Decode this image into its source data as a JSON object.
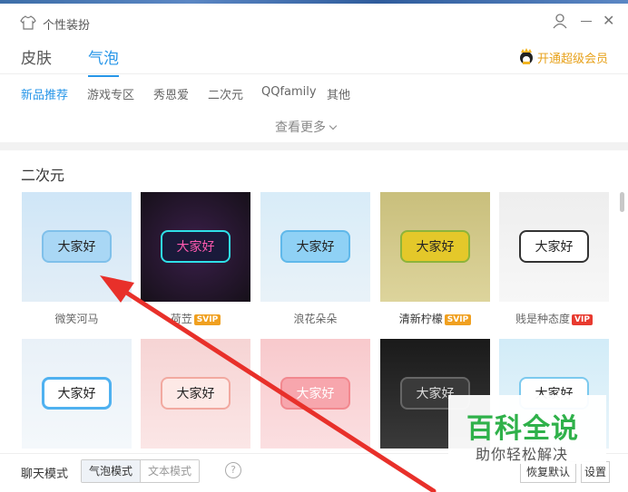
{
  "window": {
    "title": "个性装扮",
    "icons": {
      "app": "shirt-icon",
      "user": "user-icon",
      "minimize": "minimize-icon",
      "close": "close-icon"
    },
    "close_glyph": "✕"
  },
  "main_tabs": [
    {
      "label": "皮肤",
      "active": false
    },
    {
      "label": "气泡",
      "active": true
    }
  ],
  "vip": {
    "label": "开通超级会员",
    "icon": "vip-penguin-icon",
    "color": "#e7a11a"
  },
  "sub_tabs": [
    {
      "label": "新品推荐",
      "active": true
    },
    {
      "label": "游戏专区",
      "active": false
    },
    {
      "label": "秀恩爱",
      "active": false
    },
    {
      "label": "二次元",
      "active": false
    },
    {
      "label": "QQfamily",
      "active": false
    },
    {
      "label": "其他",
      "active": false
    }
  ],
  "see_more": "查看更多",
  "section": {
    "title": "二次元"
  },
  "tiles": [
    {
      "name": "微笑河马",
      "bubble_text": "大家好",
      "tag": ""
    },
    {
      "name": "荷苙",
      "bubble_text": "大家好",
      "tag": "SVIP"
    },
    {
      "name": "浪花朵朵",
      "bubble_text": "大家好",
      "tag": ""
    },
    {
      "name": "清新柠檬",
      "bubble_text": "大家好",
      "tag": "SVIP"
    },
    {
      "name": "贱是种态度",
      "bubble_text": "大家好",
      "tag": "VIP"
    },
    {
      "name": "",
      "bubble_text": "大家好",
      "tag": ""
    },
    {
      "name": "",
      "bubble_text": "大家好",
      "tag": ""
    },
    {
      "name": "",
      "bubble_text": "大家好",
      "tag": ""
    },
    {
      "name": "",
      "bubble_text": "大家好",
      "tag": ""
    },
    {
      "name": "",
      "bubble_text": "大家好",
      "tag": ""
    }
  ],
  "bottom": {
    "chat_mode_label": "聊天模式",
    "mode_bubble": "气泡模式",
    "mode_text": "文本模式",
    "help": "?",
    "restore_default": "恢复默认",
    "settings": "设置"
  },
  "watermark": {
    "title": "百科全说",
    "subtitle": "助你轻松解决"
  },
  "colors": {
    "accent": "#2796e8",
    "vip_gold": "#e7a11a",
    "arrow_red": "#e8302a",
    "watermark_green": "#2fb14a"
  }
}
